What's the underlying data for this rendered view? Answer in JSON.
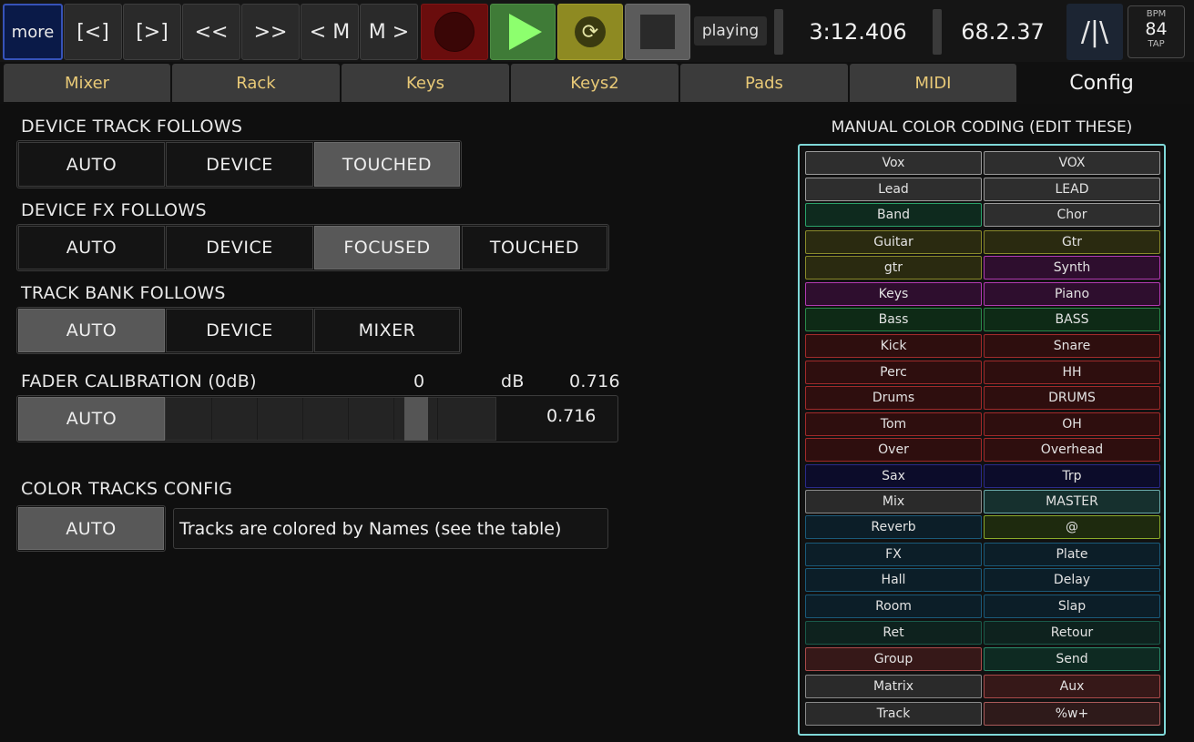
{
  "toolbar": {
    "more": "more",
    "prev_marker": "[<]",
    "next_marker": "[>]",
    "rewind": "<<",
    "forward": ">>",
    "prev_m": "< M",
    "next_m": "M >",
    "status": "playing",
    "time": "3:12.406",
    "position": "68.2.37",
    "logo": "/|\\",
    "bpm_label": "BPM",
    "bpm_value": "84",
    "tap_label": "TAP",
    "colors": {
      "record": "#6a0d0d",
      "play": "#3f7b37",
      "loop": "#8e8a22",
      "stop": "#5b5b5b"
    }
  },
  "tabs": [
    "Mixer",
    "Rack",
    "Keys",
    "Keys2",
    "Pads",
    "MIDI",
    "Config"
  ],
  "active_tab": "Config",
  "config": {
    "device_track": {
      "label": "DEVICE TRACK FOLLOWS",
      "options": [
        "AUTO",
        "DEVICE",
        "TOUCHED"
      ],
      "selected": "TOUCHED"
    },
    "device_fx": {
      "label": "DEVICE FX FOLLOWS",
      "options": [
        "AUTO",
        "DEVICE",
        "FOCUSED",
        "TOUCHED"
      ],
      "selected": "FOCUSED"
    },
    "track_bank": {
      "label": "TRACK BANK FOLLOWS",
      "options": [
        "AUTO",
        "DEVICE",
        "MIXER"
      ],
      "selected": "AUTO"
    },
    "fader": {
      "label": "FADER CALIBRATION (0dB)",
      "db_value": "0",
      "db_unit": "dB",
      "value_top": "0.716",
      "auto": "AUTO",
      "value": "0.716",
      "level_fraction": 0.716
    },
    "color_tracks": {
      "label": "COLOR TRACKS CONFIG",
      "auto": "AUTO",
      "description": "Tracks are colored by Names  (see the table)"
    }
  },
  "color_coding": {
    "title": "MANUAL COLOR CODING (EDIT THESE)",
    "rows": [
      [
        {
          "name": "Vox",
          "color": "#9a9a9a",
          "bg": "#2e2e2e"
        },
        {
          "name": "VOX",
          "color": "#9a9a9a",
          "bg": "#2e2e2e"
        }
      ],
      [
        {
          "name": "Lead",
          "color": "#9a9a9a",
          "bg": "#2e2e2e"
        },
        {
          "name": "LEAD",
          "color": "#9a9a9a",
          "bg": "#2e2e2e"
        }
      ],
      [
        {
          "name": "Band",
          "color": "#2aa26a",
          "bg": "#0e2a1e"
        },
        {
          "name": "Chor",
          "color": "#9a9a9a",
          "bg": "#2e2e2e"
        }
      ],
      [
        {
          "name": "Guitar",
          "color": "#8a8a2a",
          "bg": "#2a2a10"
        },
        {
          "name": "Gtr",
          "color": "#8a8a2a",
          "bg": "#2a2a10"
        }
      ],
      [
        {
          "name": "gtr",
          "color": "#8a8a2a",
          "bg": "#2a2a10"
        },
        {
          "name": "Synth",
          "color": "#b23ab2",
          "bg": "#2e0e2e"
        }
      ],
      [
        {
          "name": "Keys",
          "color": "#b23ab2",
          "bg": "#2e0e2e"
        },
        {
          "name": "Piano",
          "color": "#b23ab2",
          "bg": "#2e0e2e"
        }
      ],
      [
        {
          "name": "Bass",
          "color": "#2a8a4a",
          "bg": "#0e2a16"
        },
        {
          "name": "BASS",
          "color": "#2a8a4a",
          "bg": "#0e2a16"
        }
      ],
      [
        {
          "name": "Kick",
          "color": "#a22a2a",
          "bg": "#2e0e0e"
        },
        {
          "name": "Snare",
          "color": "#a22a2a",
          "bg": "#2e0e0e"
        }
      ],
      [
        {
          "name": "Perc",
          "color": "#a22a2a",
          "bg": "#2e0e0e"
        },
        {
          "name": "HH",
          "color": "#a22a2a",
          "bg": "#2e0e0e"
        }
      ],
      [
        {
          "name": "Drums",
          "color": "#a22a2a",
          "bg": "#2e0e0e"
        },
        {
          "name": "DRUMS",
          "color": "#a22a2a",
          "bg": "#2e0e0e"
        }
      ],
      [
        {
          "name": "Tom",
          "color": "#a22a2a",
          "bg": "#2e0e0e"
        },
        {
          "name": "OH",
          "color": "#a22a2a",
          "bg": "#2e0e0e"
        }
      ],
      [
        {
          "name": "Over",
          "color": "#a22a2a",
          "bg": "#2e0e0e"
        },
        {
          "name": "Overhead",
          "color": "#a22a2a",
          "bg": "#2e0e0e"
        }
      ],
      [
        {
          "name": "Sax",
          "color": "#2a2a8a",
          "bg": "#0c0c2a"
        },
        {
          "name": "Trp",
          "color": "#2a2a8a",
          "bg": "#0c0c2a"
        }
      ],
      [
        {
          "name": "Mix",
          "color": "#8a8a8a",
          "bg": "#2a2a2a"
        },
        {
          "name": "MASTER",
          "color": "#6aaaaa",
          "bg": "#16302e"
        }
      ],
      [
        {
          "name": "Reverb",
          "color": "#1a5a7a",
          "bg": "#0c1e28"
        },
        {
          "name": "@",
          "color": "#8aaa2a",
          "bg": "#1e2a0e"
        }
      ],
      [
        {
          "name": "FX",
          "color": "#1a5a7a",
          "bg": "#0c1e28"
        },
        {
          "name": "Plate",
          "color": "#1a5a7a",
          "bg": "#0c1e28"
        }
      ],
      [
        {
          "name": "Hall",
          "color": "#1a5a7a",
          "bg": "#0c1e28"
        },
        {
          "name": "Delay",
          "color": "#1a5a7a",
          "bg": "#0c1e28"
        }
      ],
      [
        {
          "name": "Room",
          "color": "#1a5a7a",
          "bg": "#0c1e28"
        },
        {
          "name": "Slap",
          "color": "#1a5a7a",
          "bg": "#0c1e28"
        }
      ],
      [
        {
          "name": "Ret",
          "color": "#1a5a4a",
          "bg": "#0e221e"
        },
        {
          "name": "Retour",
          "color": "#1a5a4a",
          "bg": "#0e221e"
        }
      ],
      [
        {
          "name": "Group",
          "color": "#aa4a4a",
          "bg": "#361818"
        },
        {
          "name": "Send",
          "color": "#2a8a6a",
          "bg": "#0e2a22"
        }
      ],
      [
        {
          "name": "Matrix",
          "color": "#8a8a8a",
          "bg": "#2a2a2a"
        },
        {
          "name": "Aux",
          "color": "#aa4a4a",
          "bg": "#361818"
        }
      ],
      [
        {
          "name": "Track",
          "color": "#8a8a8a",
          "bg": "#2a2a2a"
        },
        {
          "name": "%w+",
          "color": "#aa5a5a",
          "bg": "#2e1a1a"
        }
      ]
    ]
  }
}
